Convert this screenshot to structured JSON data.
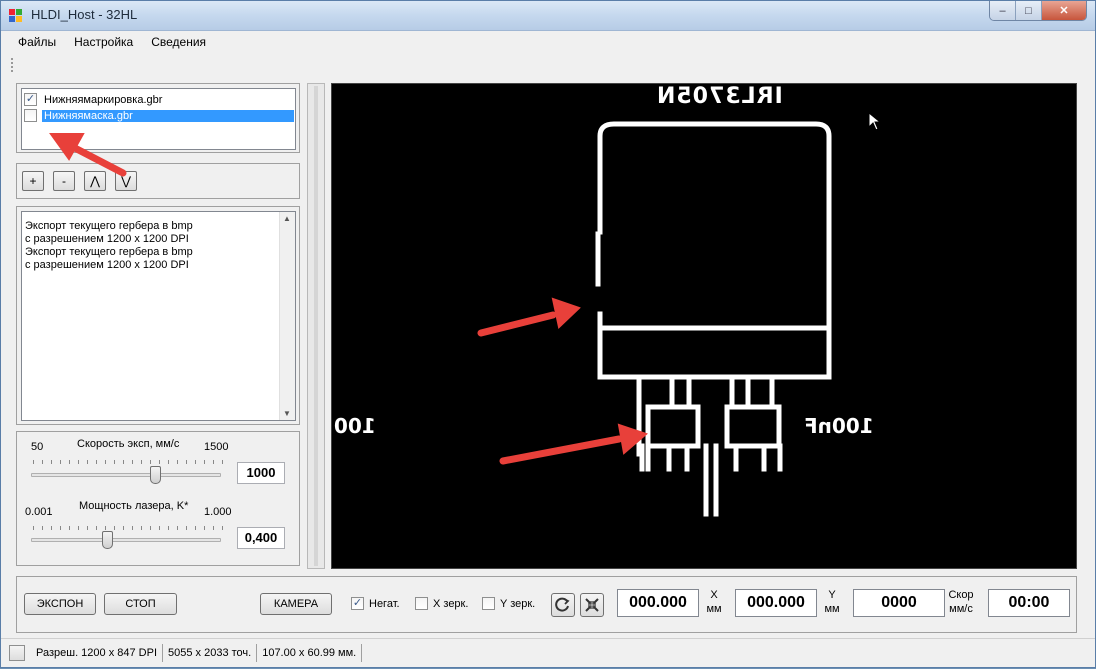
{
  "window": {
    "title": "HLDI_Host - 32HL",
    "min_glyph": "–",
    "max_glyph": "□",
    "close_glyph": "✕"
  },
  "menu": [
    "Файлы",
    "Настройка",
    "Сведения"
  ],
  "layers": [
    {
      "label": "Нижняямаркировка.gbr",
      "checked": true,
      "selected": false
    },
    {
      "label": "Нижняямаска.gbr",
      "checked": false,
      "selected": true
    }
  ],
  "layer_buttons": [
    "+",
    "-",
    "⋀",
    "⋁"
  ],
  "log": {
    "text": "Экспорт текущего гербера в bmp\nс разрешением 1200 x 1200 DPI\nЭкспорт текущего гербера в bmp\nс разрешением 1200 x 1200 DPI"
  },
  "speed": {
    "label": "Скорость эксп, мм/с",
    "min": "50",
    "max": "1500",
    "value": "1000",
    "level": 0.655
  },
  "power": {
    "label": "Мощность лазера, K*",
    "min": "0.001",
    "max": "1.000",
    "value": "0,400",
    "level": 0.4
  },
  "canvas": {
    "top_text": "IRL3705N",
    "left_text": "100",
    "right_text": "100nF"
  },
  "bottom": {
    "expose_label": "ЭКСПОН",
    "stop_label": "СТОП",
    "camera_label": "КАМЕРА",
    "negative_label": "Негат.",
    "negative_checked": true,
    "mirror_x_label": "X зерк.",
    "mirror_x_checked": false,
    "mirror_y_label": "Y зерк.",
    "mirror_y_checked": false,
    "x_value": "000.000",
    "x_unit": "X",
    "x_unit2": "мм",
    "y_value": "000.000",
    "y_unit": "Y",
    "y_unit2": "мм",
    "speed_value": "0000",
    "speed_unit": "Скор",
    "speed_unit2": "мм/с",
    "time_value": "00:00"
  },
  "status": {
    "resolution": "Разреш. 1200 x 847 DPI",
    "points": "5055 x 2033 точ.",
    "size": "107.00 x 60.99 мм."
  },
  "colors": {
    "annotation_arrow": "#e8403a",
    "selection": "#3399ff",
    "canvas_bg": "#000000",
    "trace": "#ffffff"
  }
}
